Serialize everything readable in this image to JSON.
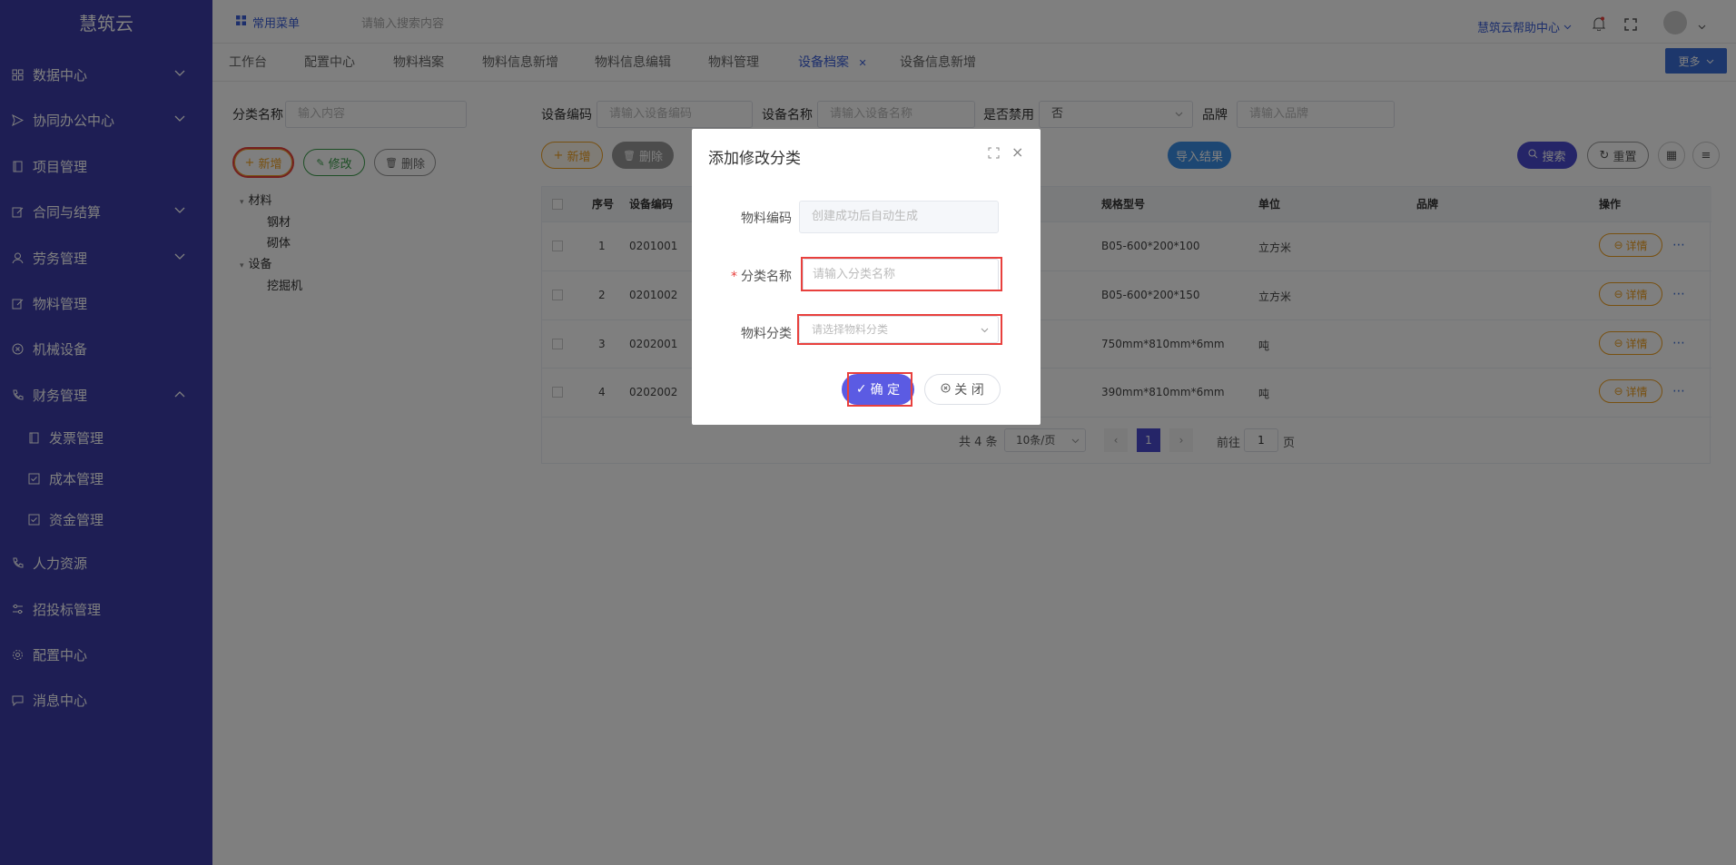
{
  "app": {
    "logo": "慧筑云"
  },
  "sidebar": {
    "items": [
      {
        "label": "数据中心",
        "icon": "grid-icon",
        "expand": "down"
      },
      {
        "label": "协同办公中心",
        "icon": "send-icon",
        "expand": "down"
      },
      {
        "label": "项目管理",
        "icon": "book-icon",
        "expand": ""
      },
      {
        "label": "合同与结算",
        "icon": "edit-icon",
        "expand": "down"
      },
      {
        "label": "劳务管理",
        "icon": "user-icon",
        "expand": "down"
      },
      {
        "label": "物料管理",
        "icon": "edit-icon",
        "expand": ""
      },
      {
        "label": "机械设备",
        "icon": "circle-x-icon",
        "expand": ""
      },
      {
        "label": "财务管理",
        "icon": "phone-icon",
        "expand": "up"
      }
    ],
    "sub_items": [
      {
        "label": "发票管理",
        "icon": "book-icon"
      },
      {
        "label": "成本管理",
        "icon": "checkbox-icon"
      },
      {
        "label": "资金管理",
        "icon": "checkbox-icon"
      }
    ],
    "bottom_items": [
      {
        "label": "人力资源",
        "icon": "phone-icon"
      },
      {
        "label": "招投标管理",
        "icon": "sliders-icon"
      },
      {
        "label": "配置中心",
        "icon": "gear-icon"
      },
      {
        "label": "消息中心",
        "icon": "message-icon"
      }
    ]
  },
  "topbar": {
    "common_menu": "常用菜单",
    "search_placeholder": "请输入搜索内容",
    "help_center": "慧筑云帮助中心"
  },
  "tabs": [
    {
      "label": "工作台"
    },
    {
      "label": "配置中心"
    },
    {
      "label": "物料档案"
    },
    {
      "label": "物料信息新增"
    },
    {
      "label": "物料信息编辑"
    },
    {
      "label": "物料管理"
    },
    {
      "label": "设备档案",
      "active": true
    },
    {
      "label": "设备信息新增"
    }
  ],
  "more_button": "更多",
  "left_panel": {
    "category_label": "分类名称",
    "category_placeholder": "输入内容",
    "add": "新增",
    "edit": "修改",
    "delete": "删除",
    "tree": {
      "material": "材料",
      "material_children": [
        "钢材",
        "砌体"
      ],
      "equipment": "设备",
      "equipment_children": [
        "挖掘机"
      ]
    }
  },
  "filters": {
    "code_label": "设备编码",
    "code_placeholder": "请输入设备编码",
    "name_label": "设备名称",
    "name_placeholder": "请输入设备名称",
    "disabled_label": "是否禁用",
    "disabled_value": "否",
    "brand_label": "品牌",
    "brand_placeholder": "请输入品牌"
  },
  "toolbar": {
    "add": "新增",
    "delete": "删除",
    "import_result": "导入结果",
    "search": "搜索",
    "reset": "重置"
  },
  "table": {
    "headers": {
      "index": "序号",
      "code": "设备编码",
      "spec": "规格型号",
      "unit": "单位",
      "brand": "品牌",
      "ops": "操作"
    },
    "rows": [
      {
        "index": "1",
        "code": "0201001",
        "spec": "B05-600*200*100",
        "unit": "立方米",
        "brand": ""
      },
      {
        "index": "2",
        "code": "0201002",
        "spec": "B05-600*200*150",
        "unit": "立方米",
        "brand": ""
      },
      {
        "index": "3",
        "code": "0202001",
        "spec": "750mm*810mm*6mm",
        "unit": "吨",
        "brand": ""
      },
      {
        "index": "4",
        "code": "0202002",
        "spec": "390mm*810mm*6mm",
        "unit": "吨",
        "brand": ""
      }
    ],
    "detail_label": "详情"
  },
  "pagination": {
    "total": "共 4 条",
    "page_size": "10条/页",
    "current": "1",
    "goto_prefix": "前往",
    "goto_value": "1",
    "goto_suffix": "页"
  },
  "dialog": {
    "title": "添加修改分类",
    "code_label": "物料编码",
    "code_placeholder": "创建成功后自动生成",
    "name_label": "分类名称",
    "name_placeholder": "请输入分类名称",
    "category_label": "物料分类",
    "category_placeholder": "请选择物料分类",
    "confirm": "确 定",
    "close": "关 闭",
    "required_mark": "*"
  },
  "colors": {
    "sidebar": "#3c3ca8",
    "accent": "#5b5be3",
    "highlight": "#e8403d",
    "warning": "#f0a020"
  }
}
